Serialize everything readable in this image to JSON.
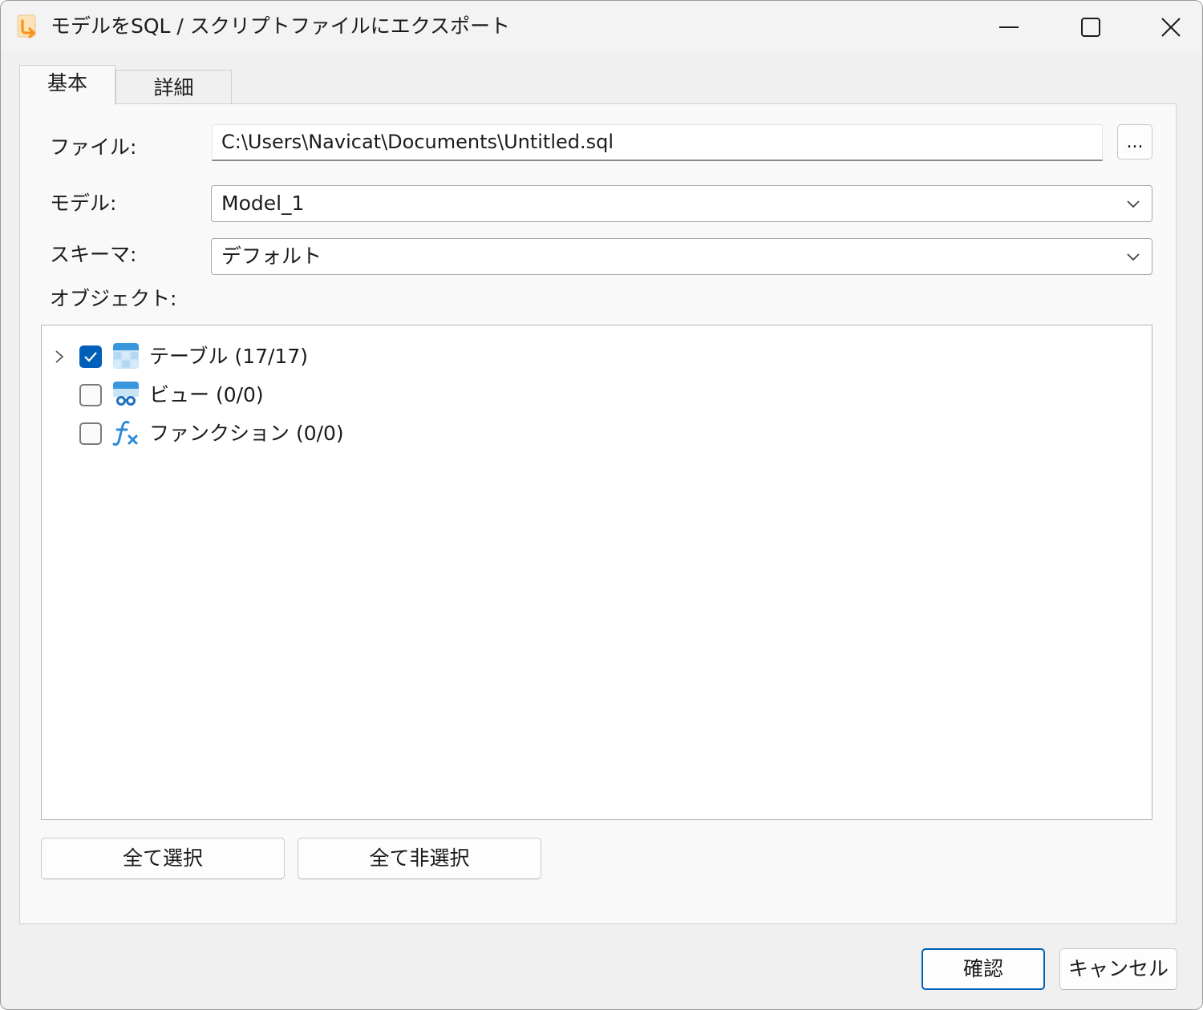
{
  "window": {
    "title": "モデルをSQL / スクリプトファイルにエクスポート",
    "app_icon": "navicat-export-icon",
    "controls": [
      "minimize-icon",
      "maximize-icon",
      "close-icon"
    ]
  },
  "tabs": [
    {
      "label": "基本",
      "active": true
    },
    {
      "label": "詳細",
      "active": false
    }
  ],
  "form": {
    "file_label": "ファイル:",
    "file_value": "C:\\Users\\Navicat\\Documents\\Untitled.sql",
    "browse_label": "...",
    "model_label": "モデル:",
    "model_value": "Model_1",
    "schema_label": "スキーマ:",
    "schema_value": "デフォルト",
    "objects_label": "オブジェクト:"
  },
  "objects": [
    {
      "label": "テーブル (17/17)",
      "checked": true,
      "expandable": true,
      "icon": "table-icon"
    },
    {
      "label": "ビュー (0/0)",
      "checked": false,
      "expandable": false,
      "icon": "view-icon"
    },
    {
      "label": "ファンクション (0/0)",
      "checked": false,
      "expandable": false,
      "icon": "function-icon"
    }
  ],
  "actions": {
    "select_all": "全て選択",
    "deselect_all": "全て非選択"
  },
  "footer": {
    "ok": "確認",
    "cancel": "キャンセル"
  },
  "colors": {
    "accent": "#005fb8",
    "icon_blue": "#3a96dd",
    "app_orange": "#f7941d"
  }
}
